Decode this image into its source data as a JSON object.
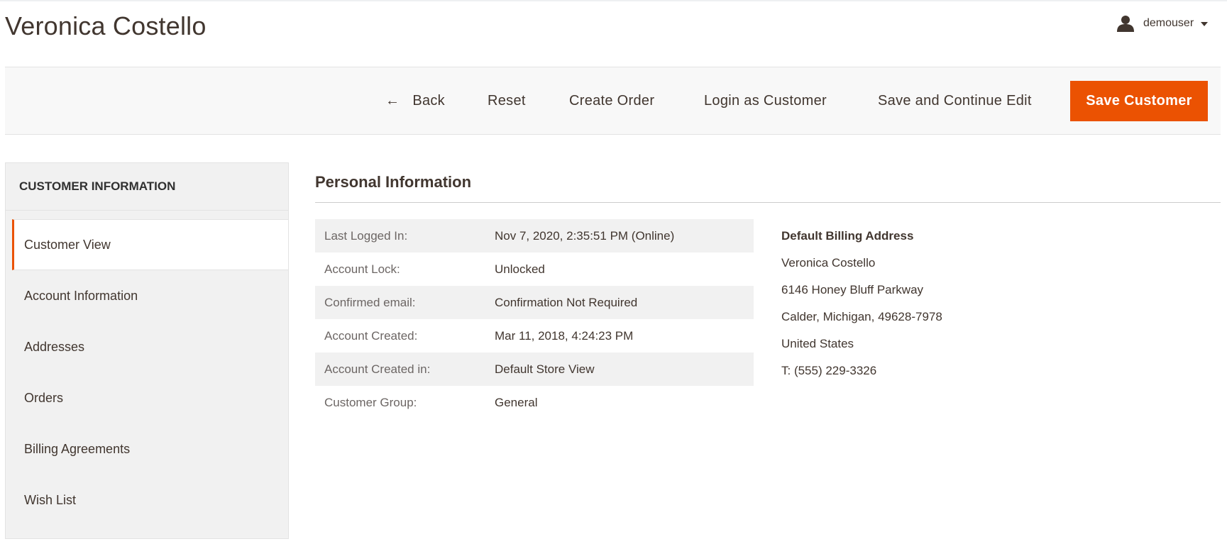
{
  "page": {
    "title": "Veronica Costello"
  },
  "user_menu": {
    "icon": "user-icon",
    "username": "demouser",
    "caret_icon": "caret-down-icon"
  },
  "toolbar": {
    "back_icon": "arrow-left-icon",
    "back_label": "Back",
    "reset_label": "Reset",
    "create_order_label": "Create Order",
    "login_as_customer_label": "Login as Customer",
    "save_continue_label": "Save and Continue Edit",
    "save_customer_label": "Save Customer"
  },
  "sidebar": {
    "title": "CUSTOMER INFORMATION",
    "items": [
      {
        "label": "Customer View",
        "active": true
      },
      {
        "label": "Account Information",
        "active": false
      },
      {
        "label": "Addresses",
        "active": false
      },
      {
        "label": "Orders",
        "active": false
      },
      {
        "label": "Billing Agreements",
        "active": false
      },
      {
        "label": "Wish List",
        "active": false
      }
    ]
  },
  "personal_info": {
    "title": "Personal Information",
    "rows": [
      {
        "label": "Last Logged In:",
        "value": "Nov 7, 2020, 2:35:51 PM (Online)"
      },
      {
        "label": "Account Lock:",
        "value": "Unlocked"
      },
      {
        "label": "Confirmed email:",
        "value": "Confirmation Not Required"
      },
      {
        "label": "Account Created:",
        "value": "Mar 11, 2018, 4:24:23 PM"
      },
      {
        "label": "Account Created in:",
        "value": "Default Store View"
      },
      {
        "label": "Customer Group:",
        "value": "General"
      }
    ]
  },
  "billing_address": {
    "title": "Default Billing Address",
    "lines": [
      "Veronica Costello",
      "6146 Honey Bluff Parkway",
      "Calder, Michigan, 49628-7978",
      "United States",
      "T: (555) 229-3326"
    ]
  },
  "colors": {
    "accent": "#eb5202",
    "text": "#41362f",
    "panel_bg": "#f1f1f1",
    "toolbar_bg": "#f8f8f8"
  }
}
